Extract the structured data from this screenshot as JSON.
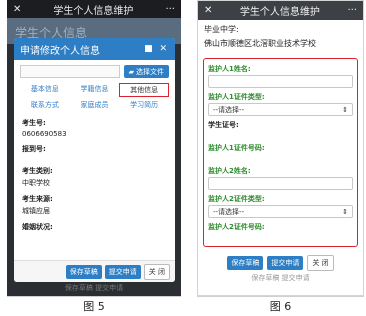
{
  "figure5": {
    "header": {
      "close_icon": "✕",
      "title": "学生个人信息维护",
      "more_icon": "···"
    },
    "underlay_title": "学生个人信息",
    "modal": {
      "title": "申请修改个人信息",
      "controls": "■ ✕",
      "file_button": "选择文件",
      "tabs": [
        "基本信息",
        "学籍信息",
        "其他信息",
        "联系方式",
        "家庭成员",
        "学习简历"
      ],
      "selected_tab": "其他信息",
      "fields": {
        "exam_no_label": "考生号:",
        "exam_no_value": "0606690583",
        "report_no_label": "报到号:",
        "category_label": "考生类别:",
        "category_value": "中职学校",
        "source_label": "考生来源:",
        "source_value": "城镇应届",
        "marital_label": "婚姻状况:"
      },
      "buttons": {
        "save_draft": "保存草稿",
        "submit": "提交申请",
        "close": "关 闭"
      }
    },
    "ghost_text": "保存草稿  提交申请"
  },
  "figure6": {
    "header": {
      "close_icon": "✕",
      "title": "学生个人信息维护",
      "more_icon": "···"
    },
    "graduated_label": "毕业中学:",
    "graduated_value": "佛山市顺德区北滘职业技术学校",
    "guardian_fields": {
      "g1_name_label": "监护人1姓名:",
      "g1_id_type_label": "监护人1证件类型:",
      "g1_id_type_value": "--请选择--",
      "student_id_label": "学生证号:",
      "g1_id_no_label": "监护人1证件号码:",
      "g2_name_label": "监护人2姓名:",
      "g2_id_type_label": "监护人2证件类型:",
      "g2_id_type_value": "--请选择--",
      "g2_id_no_label": "监护人2证件号码:"
    },
    "buttons": {
      "save_draft": "保存草稿",
      "submit": "提交申请",
      "close": "关 闭"
    },
    "ghost_text": "保存草稿  提交申请"
  },
  "captions": {
    "fig5": "图 5",
    "fig6": "图 6"
  },
  "colors": {
    "accent_blue": "#2d7ec4",
    "highlight_red": "#d9232e",
    "label_green": "#2e8b2e"
  }
}
